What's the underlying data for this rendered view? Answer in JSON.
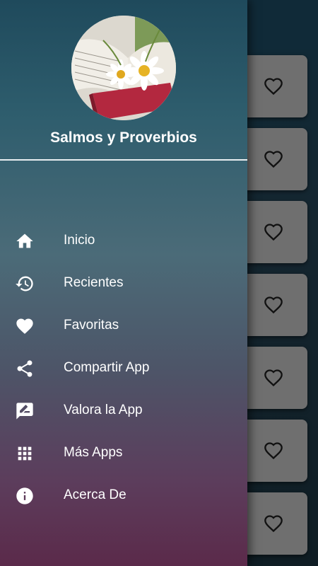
{
  "drawer": {
    "title": "Salmos y Proverbios",
    "items": [
      {
        "label": "Inicio",
        "icon": "home-icon"
      },
      {
        "label": "Recientes",
        "icon": "history-icon"
      },
      {
        "label": "Favoritas",
        "icon": "heart-icon"
      },
      {
        "label": "Compartir App",
        "icon": "share-icon"
      },
      {
        "label": "Valora la App",
        "icon": "rate-review-icon"
      },
      {
        "label": "Más Apps",
        "icon": "apps-grid-icon"
      },
      {
        "label": "Acerca De",
        "icon": "info-icon"
      }
    ]
  },
  "background": {
    "cards": [
      {
        "icon": "heart-outline-icon"
      },
      {
        "icon": "heart-outline-icon"
      },
      {
        "icon": "heart-outline-icon"
      },
      {
        "icon": "heart-outline-icon"
      },
      {
        "icon": "heart-outline-icon"
      },
      {
        "icon": "heart-outline-icon"
      },
      {
        "icon": "heart-outline-icon"
      }
    ]
  },
  "colors": {
    "drawer_top": "#1f4a5c",
    "drawer_bottom": "#5b2a4a",
    "text": "#ffffff",
    "card": "#6f6f6f"
  }
}
